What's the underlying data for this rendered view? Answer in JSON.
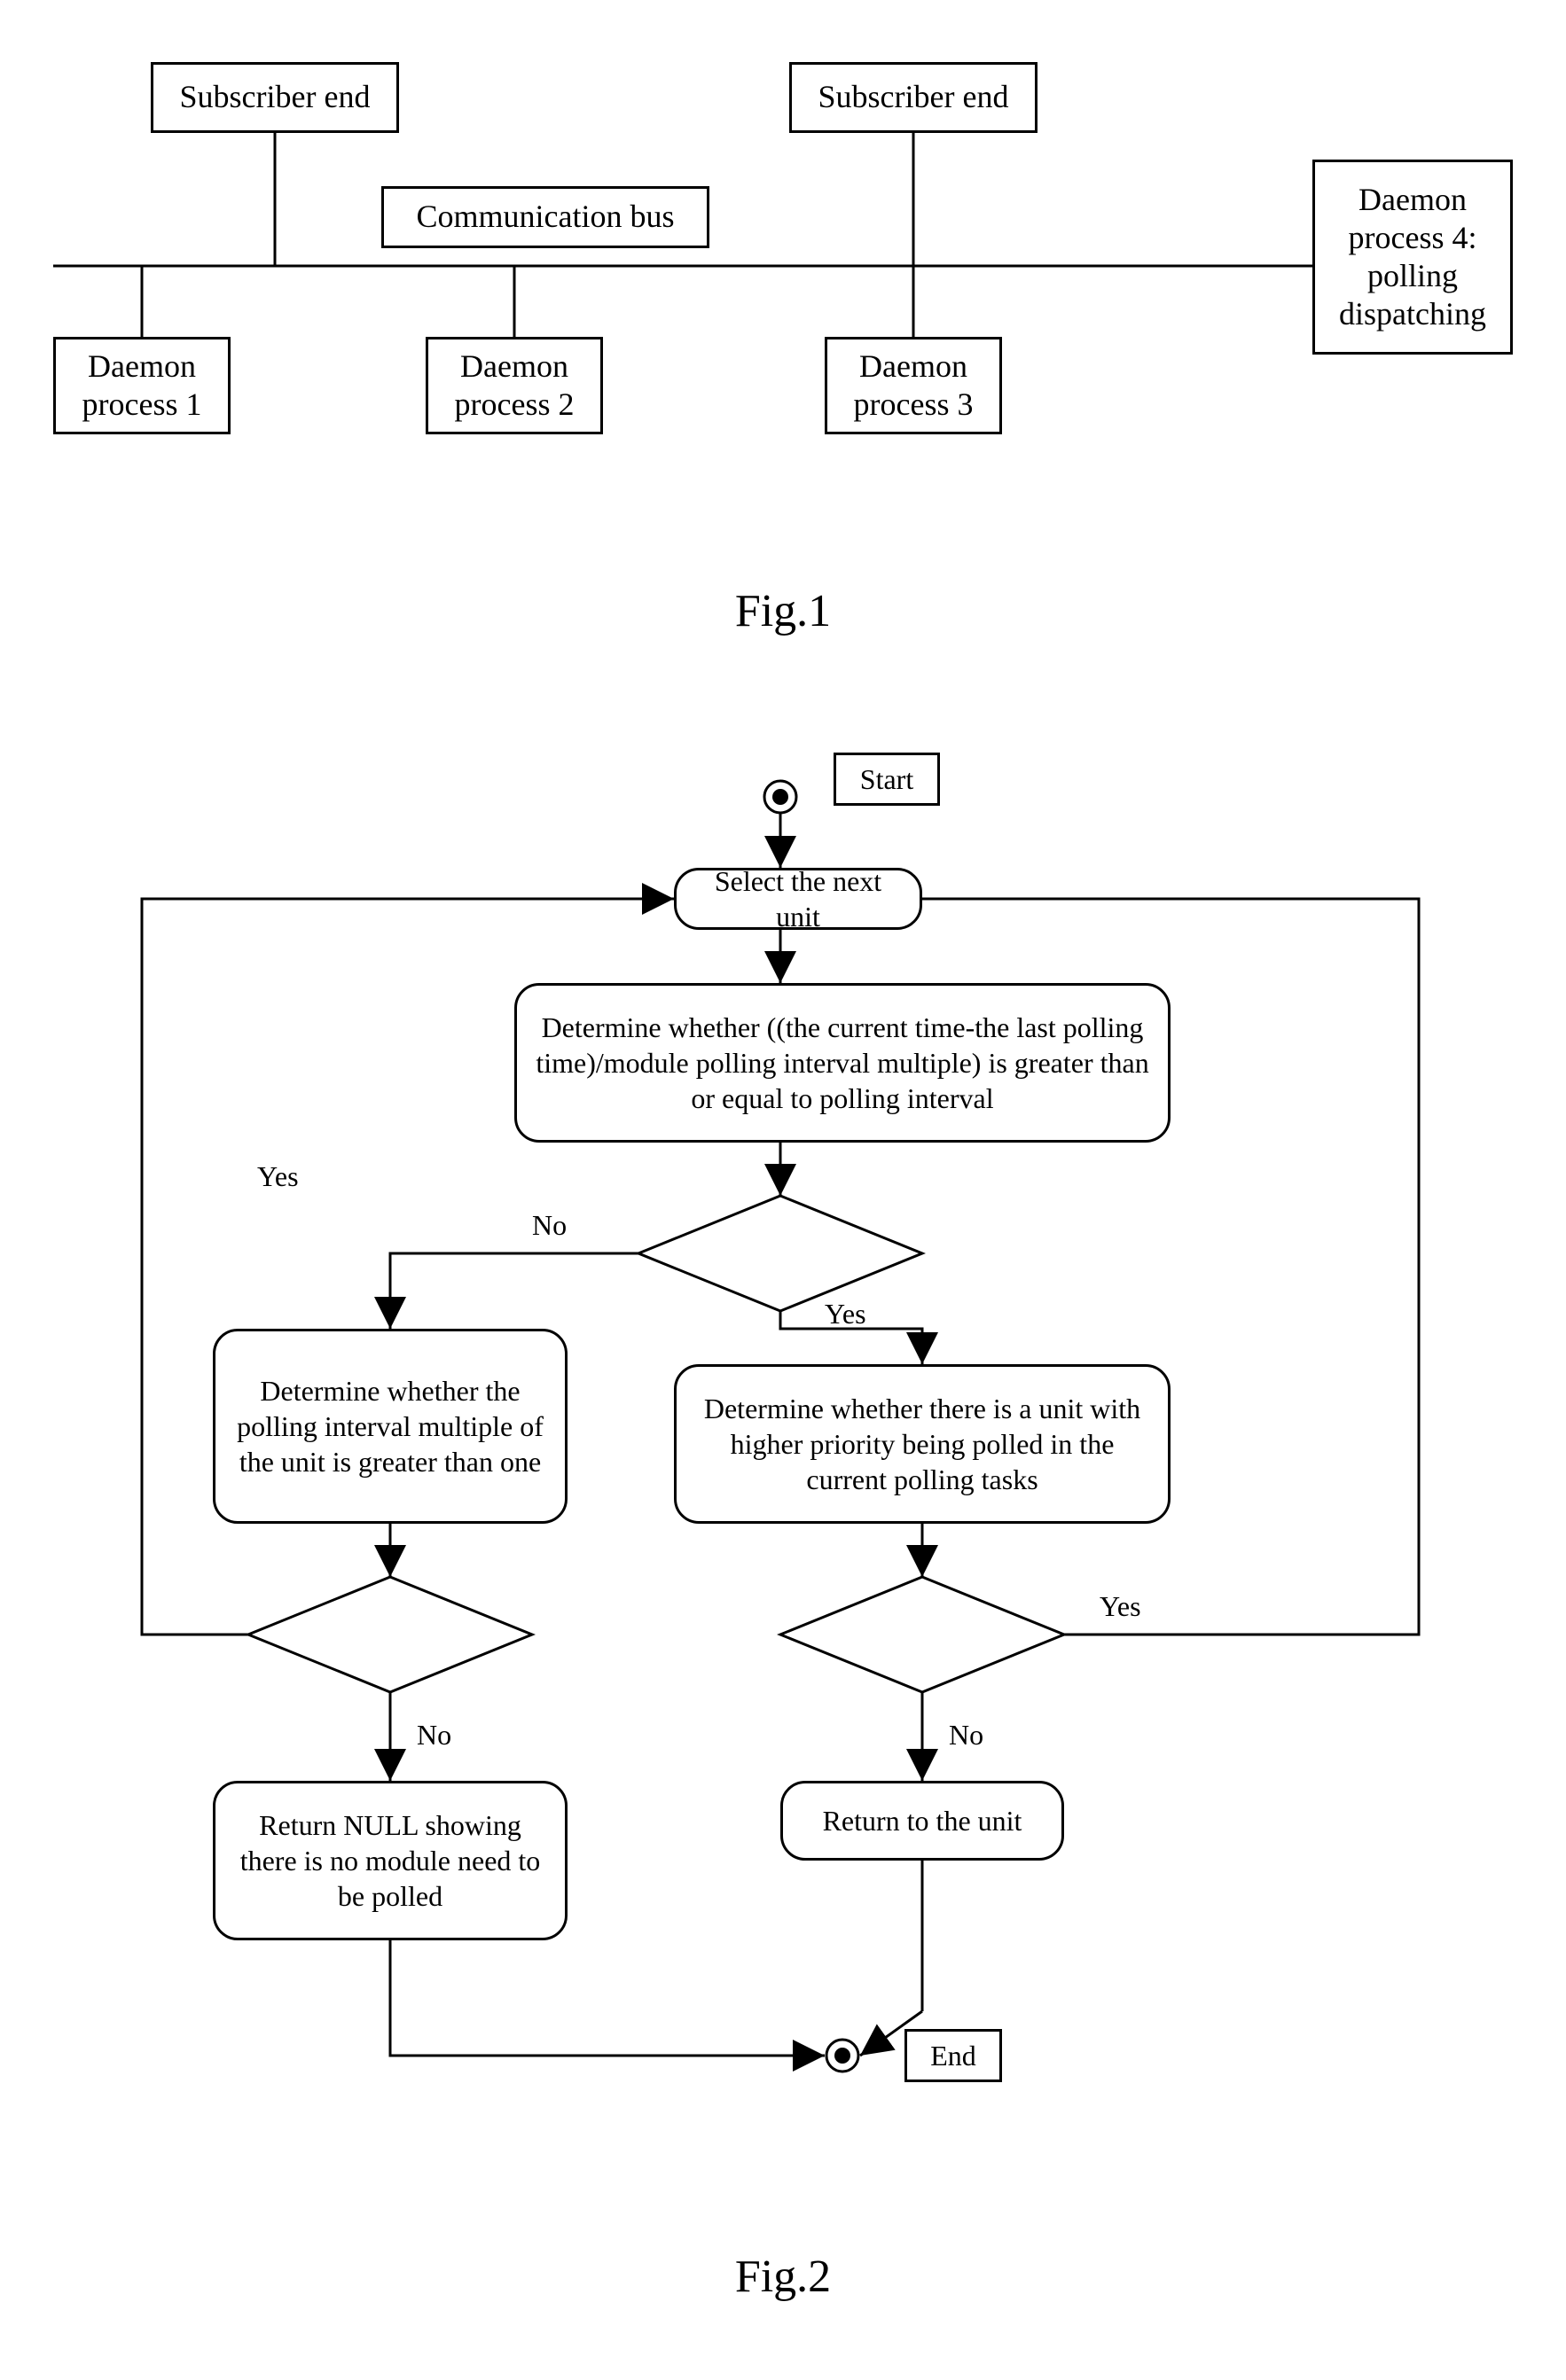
{
  "fig1": {
    "caption": "Fig.1",
    "subscriber_end_1": "Subscriber end",
    "subscriber_end_2": "Subscriber end",
    "communication_bus": "Communication bus",
    "daemon_1": "Daemon process 1",
    "daemon_2": "Daemon process 2",
    "daemon_3": "Daemon process 3",
    "daemon_4": "Daemon process 4: polling dispatching"
  },
  "fig2": {
    "caption": "Fig.2",
    "start": "Start",
    "end": "End",
    "select_next": "Select the next unit",
    "check_interval": "Determine whether ((the current time-the last polling time)/module polling interval multiple) is greater than or equal to polling interval",
    "check_multiple": "Determine whether the polling interval multiple of the unit is greater than one",
    "check_priority": "Determine whether there is a unit with higher priority being polled in the current polling tasks",
    "return_null": "Return NULL showing there is no module need to be polled",
    "return_unit": "Return to the unit",
    "yes": "Yes",
    "no": "No"
  }
}
